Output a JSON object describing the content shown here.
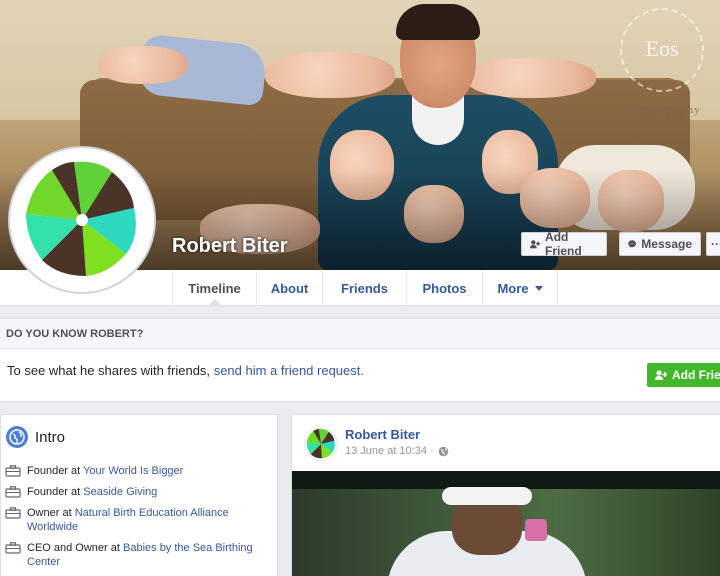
{
  "cover": {
    "watermark_title": "Eos",
    "watermark_subtitle": "Photography"
  },
  "profile": {
    "name": "Robert Biter"
  },
  "cover_actions": {
    "add_friend_label": "Add Friend",
    "message_label": "Message",
    "more_label": "···"
  },
  "tabs": [
    {
      "label": "Timeline",
      "active": true
    },
    {
      "label": "About"
    },
    {
      "label": "Friends"
    },
    {
      "label": "Photos"
    },
    {
      "label": "More"
    }
  ],
  "know_box": {
    "heading": "DO YOU KNOW ROBERT?",
    "text_prefix": "To see what he shares with friends,",
    "link_text": "send him a friend request.",
    "button_label": "Add Friend"
  },
  "intro": {
    "title": "Intro",
    "items": [
      {
        "prefix": "Founder at",
        "link": "Your World Is Bigger"
      },
      {
        "prefix": "Founder at",
        "link": "Seaside Giving"
      },
      {
        "prefix": "Owner at",
        "link": "Natural Birth Education Alliance Worldwide"
      },
      {
        "prefix": "CEO and Owner at",
        "link": "Babies by the Sea Birthing Center"
      }
    ]
  },
  "post": {
    "author": "Robert Biter",
    "time": "13 June at 10:34 ·"
  },
  "colors": {
    "link": "#365899",
    "green_button": "#42b72a",
    "page_bg": "#e9ebee"
  },
  "icons": {
    "globe": "globe-icon",
    "briefcase": "briefcase-icon",
    "add_friend": "add-friend-icon",
    "messenger": "messenger-icon",
    "public": "public-icon"
  }
}
